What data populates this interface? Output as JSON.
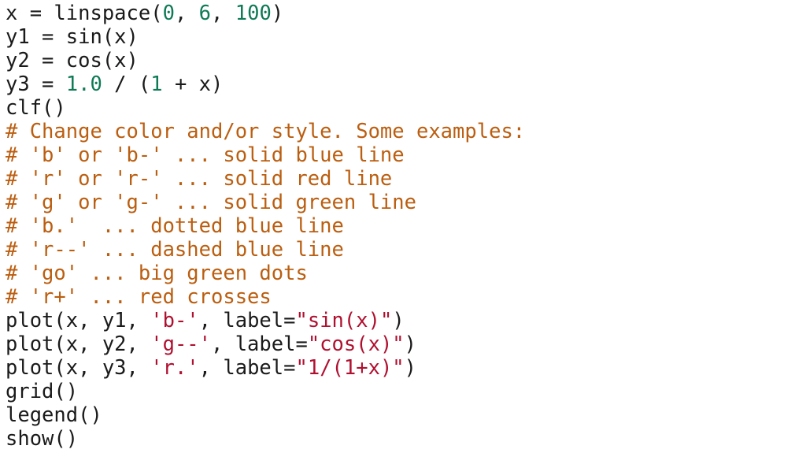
{
  "editor": {
    "language": "python",
    "background_color": "#ffffff",
    "font_style": "monospace",
    "colors": {
      "plain": "#1a1a1a",
      "number": "#0e7a55",
      "comment": "#bb5e10",
      "string": "#b01030"
    }
  },
  "code": {
    "lines": [
      {
        "index": 1,
        "text": "x = linspace(0, 6, 100)",
        "tokens": [
          {
            "t": "x = linspace(",
            "k": "plain"
          },
          {
            "t": "0",
            "k": "number"
          },
          {
            "t": ", ",
            "k": "plain"
          },
          {
            "t": "6",
            "k": "number"
          },
          {
            "t": ", ",
            "k": "plain"
          },
          {
            "t": "100",
            "k": "number"
          },
          {
            "t": ")",
            "k": "plain"
          }
        ]
      },
      {
        "index": 2,
        "text": "y1 = sin(x)",
        "tokens": [
          {
            "t": "y1 = sin(x)",
            "k": "plain"
          }
        ]
      },
      {
        "index": 3,
        "text": "y2 = cos(x)",
        "tokens": [
          {
            "t": "y2 = cos(x)",
            "k": "plain"
          }
        ]
      },
      {
        "index": 4,
        "text": "y3 = 1.0 / (1 + x)",
        "tokens": [
          {
            "t": "y3 = ",
            "k": "plain"
          },
          {
            "t": "1.0",
            "k": "number"
          },
          {
            "t": " / (",
            "k": "plain"
          },
          {
            "t": "1",
            "k": "number"
          },
          {
            "t": " + x)",
            "k": "plain"
          }
        ]
      },
      {
        "index": 5,
        "text": "clf()",
        "tokens": [
          {
            "t": "clf()",
            "k": "plain"
          }
        ]
      },
      {
        "index": 6,
        "text": "# Change color and/or style. Some examples:",
        "tokens": [
          {
            "t": "# Change color and/or style. Some examples:",
            "k": "comment"
          }
        ]
      },
      {
        "index": 7,
        "text": "# 'b' or 'b-' ... solid blue line",
        "tokens": [
          {
            "t": "# 'b' or 'b-' ... solid blue line",
            "k": "comment"
          }
        ]
      },
      {
        "index": 8,
        "text": "# 'r' or 'r-' ... solid red line",
        "tokens": [
          {
            "t": "# 'r' or 'r-' ... solid red line",
            "k": "comment"
          }
        ]
      },
      {
        "index": 9,
        "text": "# 'g' or 'g-' ... solid green line",
        "tokens": [
          {
            "t": "# 'g' or 'g-' ... solid green line",
            "k": "comment"
          }
        ]
      },
      {
        "index": 10,
        "text": "# 'b.'  ... dotted blue line",
        "tokens": [
          {
            "t": "# 'b.'  ... dotted blue line",
            "k": "comment"
          }
        ]
      },
      {
        "index": 11,
        "text": "# 'r--' ... dashed blue line",
        "tokens": [
          {
            "t": "# 'r--' ... dashed blue line",
            "k": "comment"
          }
        ]
      },
      {
        "index": 12,
        "text": "# 'go' ... big green dots",
        "tokens": [
          {
            "t": "# 'go' ... big green dots",
            "k": "comment"
          }
        ]
      },
      {
        "index": 13,
        "text": "# 'r+' ... red crosses",
        "tokens": [
          {
            "t": "# 'r+' ... red crosses",
            "k": "comment"
          }
        ]
      },
      {
        "index": 14,
        "text": "plot(x, y1, 'b-', label=\"sin(x)\")",
        "tokens": [
          {
            "t": "plot(x, y1, ",
            "k": "plain"
          },
          {
            "t": "'b-'",
            "k": "string"
          },
          {
            "t": ", label=",
            "k": "plain"
          },
          {
            "t": "\"sin(x)\"",
            "k": "string"
          },
          {
            "t": ")",
            "k": "plain"
          }
        ]
      },
      {
        "index": 15,
        "text": "plot(x, y2, 'g--', label=\"cos(x)\")",
        "tokens": [
          {
            "t": "plot(x, y2, ",
            "k": "plain"
          },
          {
            "t": "'g--'",
            "k": "string"
          },
          {
            "t": ", label=",
            "k": "plain"
          },
          {
            "t": "\"cos(x)\"",
            "k": "string"
          },
          {
            "t": ")",
            "k": "plain"
          }
        ]
      },
      {
        "index": 16,
        "text": "plot(x, y3, 'r.', label=\"1/(1+x)\")",
        "tokens": [
          {
            "t": "plot(x, y3, ",
            "k": "plain"
          },
          {
            "t": "'r.'",
            "k": "string"
          },
          {
            "t": ", label=",
            "k": "plain"
          },
          {
            "t": "\"1/(1+x)\"",
            "k": "string"
          },
          {
            "t": ")",
            "k": "plain"
          }
        ]
      },
      {
        "index": 17,
        "text": "grid()",
        "tokens": [
          {
            "t": "grid()",
            "k": "plain"
          }
        ]
      },
      {
        "index": 18,
        "text": "legend()",
        "tokens": [
          {
            "t": "legend()",
            "k": "plain"
          }
        ]
      },
      {
        "index": 19,
        "text": "show()",
        "tokens": [
          {
            "t": "show()",
            "k": "plain"
          }
        ]
      }
    ]
  }
}
